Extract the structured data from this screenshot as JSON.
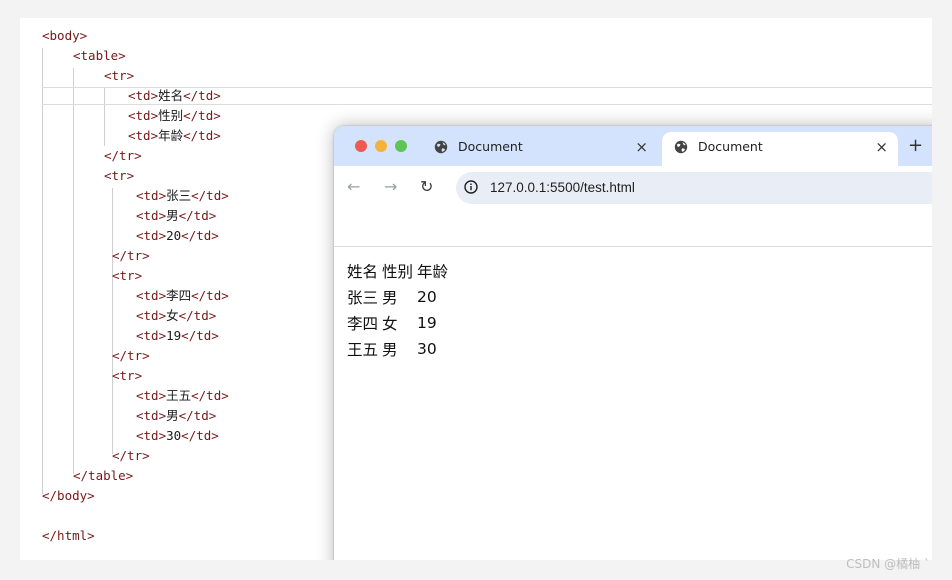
{
  "editor": {
    "lines": [
      {
        "a": "<body>",
        "b": "",
        "c": ""
      },
      {
        "a": "<table>",
        "b": "",
        "c": ""
      },
      {
        "a": "<tr>",
        "b": "",
        "c": ""
      },
      {
        "a": "<td>",
        "b": "姓名",
        "c": "</td>"
      },
      {
        "a": "<td>",
        "b": "性别",
        "c": "</td>"
      },
      {
        "a": "<td>",
        "b": "年龄",
        "c": "</td>"
      },
      {
        "a": "</tr>",
        "b": "",
        "c": ""
      },
      {
        "a": "<tr>",
        "b": "",
        "c": ""
      },
      {
        "a": "<td>",
        "b": "张三",
        "c": "</td>"
      },
      {
        "a": "<td>",
        "b": "男",
        "c": "</td>"
      },
      {
        "a": "<td>",
        "b": "20",
        "c": "</td>"
      },
      {
        "a": "</tr>",
        "b": "",
        "c": ""
      },
      {
        "a": "<tr>",
        "b": "",
        "c": ""
      },
      {
        "a": "<td>",
        "b": "李四",
        "c": "</td>"
      },
      {
        "a": "<td>",
        "b": "女",
        "c": "</td>"
      },
      {
        "a": "<td>",
        "b": "19",
        "c": "</td>"
      },
      {
        "a": "</tr>",
        "b": "",
        "c": ""
      },
      {
        "a": "<tr>",
        "b": "",
        "c": ""
      },
      {
        "a": "<td>",
        "b": "王五",
        "c": "</td>"
      },
      {
        "a": "<td>",
        "b": "男",
        "c": "</td>"
      },
      {
        "a": "<td>",
        "b": "30",
        "c": "</td>"
      },
      {
        "a": "</tr>",
        "b": "",
        "c": ""
      },
      {
        "a": "</table>",
        "b": "",
        "c": ""
      },
      {
        "a": "</body>",
        "b": "",
        "c": ""
      },
      {
        "a": "",
        "b": "",
        "c": ""
      },
      {
        "a": "</html>",
        "b": "",
        "c": ""
      }
    ]
  },
  "browser": {
    "tabs": [
      {
        "title": "Document",
        "close": "×"
      },
      {
        "title": "Document",
        "close": "×"
      }
    ],
    "new_tab": "+",
    "nav": {
      "back": "←",
      "forward": "→",
      "reload": "↻"
    },
    "url": "127.0.0.1:5500/test.html"
  },
  "rendered_table": {
    "rows": [
      [
        "姓名",
        "性别",
        "年龄"
      ],
      [
        "张三",
        "男",
        "20"
      ],
      [
        "李四",
        "女",
        "19"
      ],
      [
        "王五",
        "男",
        "30"
      ]
    ]
  },
  "watermark": "CSDN @橘柚 `",
  "colors": {
    "tag": "#7a1616",
    "tabstrip": "#d3e3fd",
    "omnibox": "#e9eef6",
    "traffic_red": "#ee5a52",
    "traffic_yellow": "#f4b23a",
    "traffic_green": "#5ec453"
  }
}
